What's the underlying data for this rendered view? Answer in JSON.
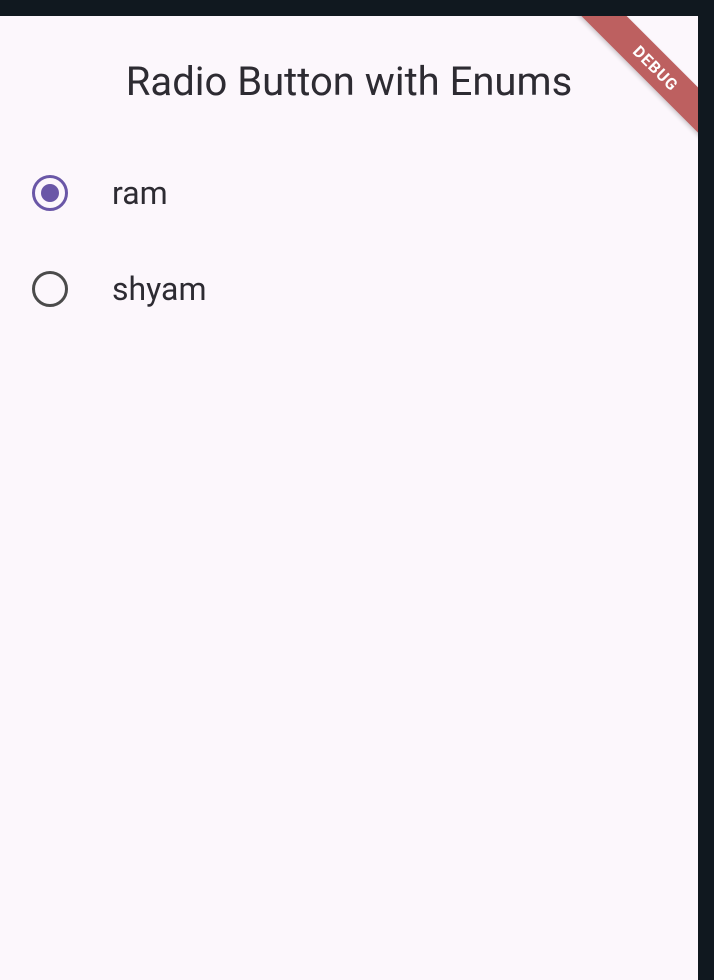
{
  "header": {
    "title": "Radio Button with Enums"
  },
  "debug_banner": {
    "label": "DEBUG"
  },
  "radio_group": {
    "options": [
      {
        "label": "ram",
        "selected": true
      },
      {
        "label": "shyam",
        "selected": false
      }
    ]
  }
}
